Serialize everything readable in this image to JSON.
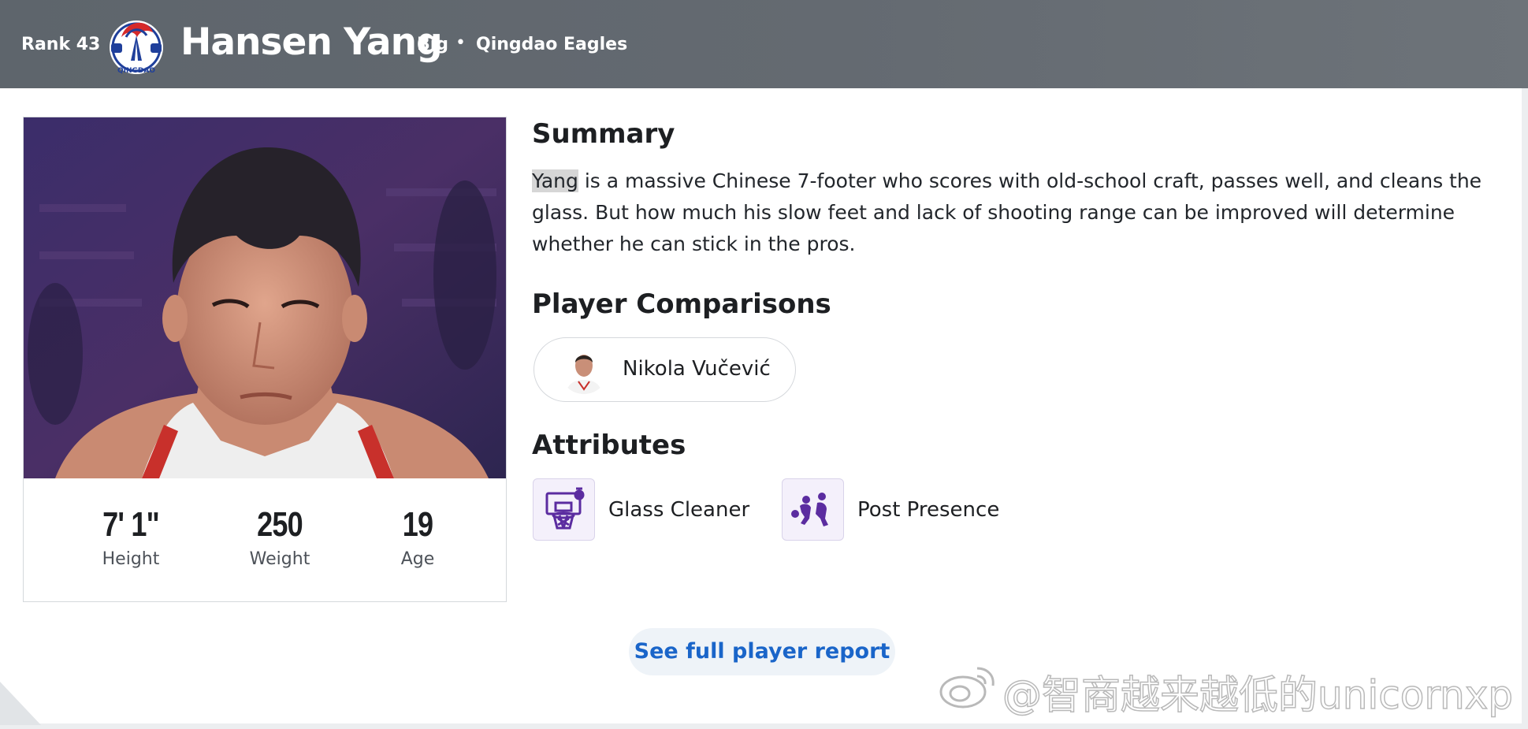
{
  "header": {
    "rank": "Rank 43",
    "player_name": "Hansen Yang",
    "position": "Big",
    "separator": "•",
    "team": "Qingdao Eagles",
    "logo_text": "QINGDAO"
  },
  "card": {
    "stats": [
      {
        "value": "7' 1\"",
        "label": "Height"
      },
      {
        "value": "250",
        "label": "Weight"
      },
      {
        "value": "19",
        "label": "Age"
      }
    ]
  },
  "summary": {
    "heading": "Summary",
    "highlighted_word": "Yang",
    "text": " is a massive Chinese 7-footer who scores with old-school craft, passes well, and cleans the glass. But how much his slow feet and lack of shooting range can be improved will determine whether he can stick in the pros."
  },
  "comparisons": {
    "heading": "Player Comparisons",
    "players": [
      {
        "name": "Nikola Vučević"
      }
    ]
  },
  "attributes": {
    "heading": "Attributes",
    "items": [
      {
        "label": "Glass Cleaner",
        "icon": "basketball-hoop-icon"
      },
      {
        "label": "Post Presence",
        "icon": "post-up-players-icon"
      }
    ]
  },
  "report_button": {
    "label": "See full player report"
  },
  "watermark": {
    "text": "@智商越来越低的unicornxp",
    "icon": "weibo-icon"
  },
  "colors": {
    "header_bg": "#646a71",
    "link_blue": "#1a65c9",
    "attr_purple": "#5b2ca0",
    "attr_bg": "#f4f0fb"
  }
}
